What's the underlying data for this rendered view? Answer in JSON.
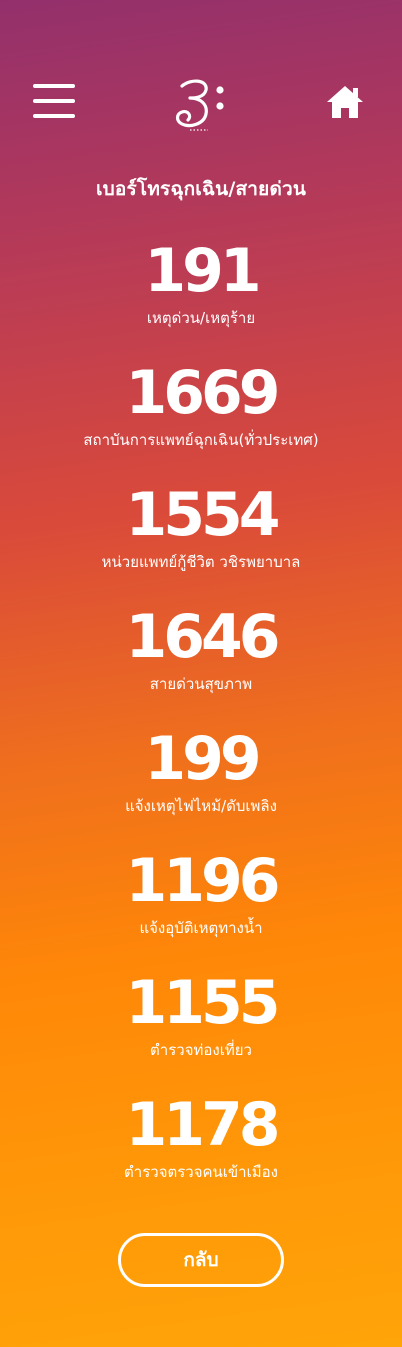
{
  "header": {
    "menu_icon": "hamburger-menu-icon",
    "logo_icon": "thai-script-logo",
    "home_icon": "home-icon"
  },
  "title": "เบอร์โทรฉุกเฉิน/สายด่วน",
  "hotlines": [
    {
      "number": "191",
      "label": "เหตุด่วน/เหตุร้าย"
    },
    {
      "number": "1669",
      "label": "สถาบันการแพทย์ฉุกเฉิน(ทั่วประเทศ)"
    },
    {
      "number": "1554",
      "label": "หน่วยแพทย์กู้ชีวิต วชิรพยาบาล"
    },
    {
      "number": "1646",
      "label": "สายด่วนสุขภาพ"
    },
    {
      "number": "199",
      "label": "แจ้งเหตุไฟไหม้/ดับเพลิง"
    },
    {
      "number": "1196",
      "label": "แจ้งอุบัติเหตุทางน้ำ"
    },
    {
      "number": "1155",
      "label": "ตำรวจท่องเที่ยว"
    },
    {
      "number": "1178",
      "label": "ตำรวจตรวจคนเข้าเมือง"
    }
  ],
  "back_button": "กลับ",
  "colors": {
    "gradient_top": "#93306c",
    "gradient_mid": "#da4a3a",
    "gradient_bottom": "#ffa409",
    "text": "#ffffff"
  }
}
